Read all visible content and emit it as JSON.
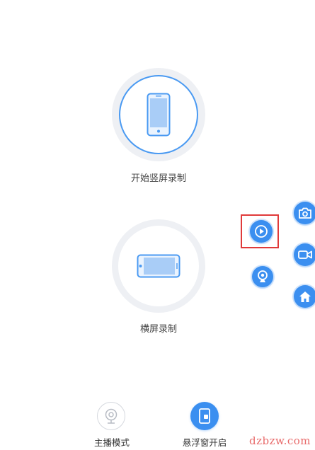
{
  "portrait": {
    "label": "开始竖屏录制"
  },
  "landscape": {
    "label": "横屏录制"
  },
  "floating_menu": {
    "items": [
      "play",
      "webcam",
      "camera",
      "video",
      "home"
    ],
    "highlight_color": "#e03a3a"
  },
  "bottom_nav": {
    "anchor_label": "主播模式",
    "float_window_label": "悬浮窗开启"
  },
  "watermark": "dzbzw.com",
  "colors": {
    "accent": "#3b8ff0",
    "ring": "#eef0f4"
  }
}
